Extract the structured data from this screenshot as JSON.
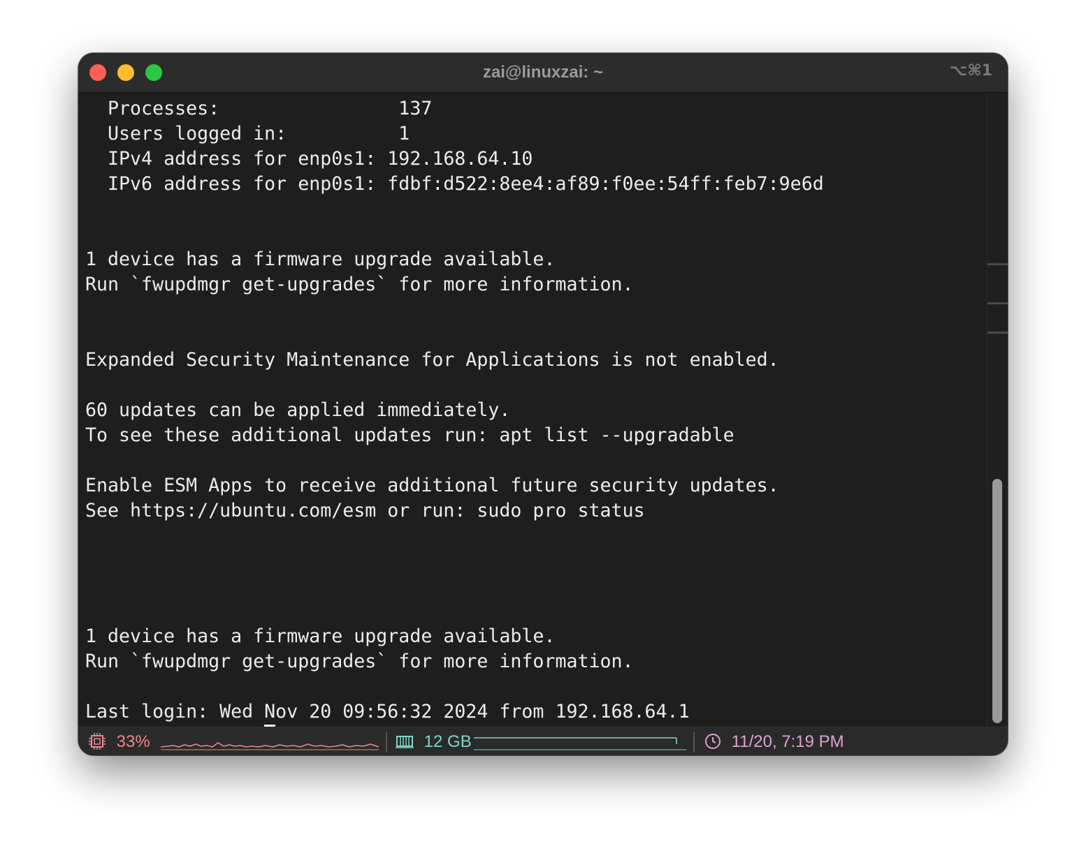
{
  "window": {
    "title": "zai@linuxzai: ~",
    "shortcut": "⌥⌘1"
  },
  "terminal": {
    "lines": [
      "  Processes:                137",
      "  Users logged in:          1",
      "  IPv4 address for enp0s1: 192.168.64.10",
      "  IPv6 address for enp0s1: fdbf:d522:8ee4:af89:f0ee:54ff:feb7:9e6d",
      "",
      "",
      "1 device has a firmware upgrade available.",
      "Run `fwupdmgr get-upgrades` for more information.",
      "",
      "",
      "Expanded Security Maintenance for Applications is not enabled.",
      "",
      "60 updates can be applied immediately.",
      "To see these additional updates run: apt list --upgradable",
      "",
      "Enable ESM Apps to receive additional future security updates.",
      "See https://ubuntu.com/esm or run: sudo pro status",
      "",
      "",
      "",
      "",
      "1 device has a firmware upgrade available.",
      "Run `fwupdmgr get-upgrades` for more information.",
      "",
      "Last login: Wed Nov 20 09:56:32 2024 from 192.168.64.1"
    ],
    "prompt": {
      "user_host": "zai@linuxzai",
      "separator": ":",
      "path": "~",
      "sign": "$ "
    }
  },
  "statusbar": {
    "cpu": {
      "icon": "cpu-icon",
      "value": "33%",
      "color": "#e88a8a"
    },
    "memory": {
      "icon": "memory-icon",
      "value": "12 GB",
      "color": "#7fd6c8"
    },
    "clock": {
      "icon": "clock-icon",
      "value": "11/20, 7:19 PM",
      "color": "#d9a3d6"
    }
  }
}
